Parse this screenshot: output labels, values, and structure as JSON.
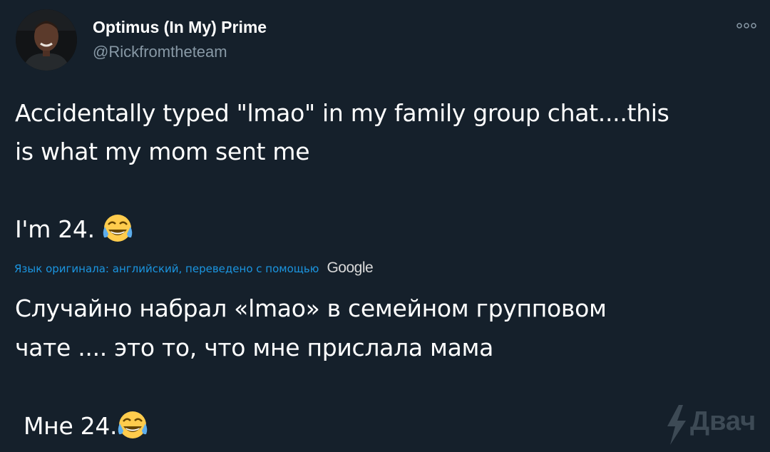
{
  "author": {
    "display_name": "Optimus (In My) Prime",
    "handle": "@Rickfromtheteam",
    "avatar_icon": "profile-photo"
  },
  "menu": {
    "icon": "more-dots-icon"
  },
  "tweet": {
    "line1": "Accidentally typed \"lmao\" in my family group chat....this",
    "line2": "is what my mom sent me",
    "line3": "I'm 24.",
    "emoji": "face-with-tears-of-joy"
  },
  "translation": {
    "source_note": "Язык оригинала: английский, переведено с помощью",
    "provider": "Google",
    "line1": "Случайно набрал «lmao» в семейном групповом",
    "line2": "чате .... это то, что мне прислала мама",
    "line3": "Мне 24."
  },
  "watermark": {
    "text": "Двач",
    "icon": "lightning-bolt-icon"
  },
  "colors": {
    "background": "#15202b",
    "text": "#ffffff",
    "secondary": "#8899a6",
    "link": "#1b95e0"
  }
}
